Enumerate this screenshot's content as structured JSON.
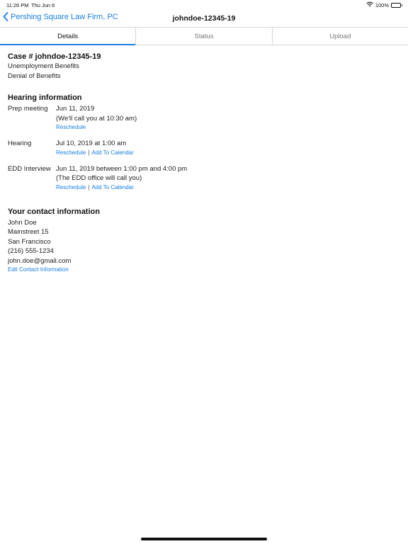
{
  "status_bar": {
    "time": "11:26 PM",
    "date": "Thu Jun 6",
    "battery": "100%"
  },
  "nav": {
    "back_label": "Pershing Square Law Firm, PC",
    "title": "johndoe-12345-19"
  },
  "tabs": [
    {
      "label": "Details",
      "active": true
    },
    {
      "label": "Status",
      "active": false
    },
    {
      "label": "Upload",
      "active": false
    }
  ],
  "case": {
    "title": "Case # johndoe-12345-19",
    "lines": [
      "Unemployment Benefits",
      "Denial of Benefits"
    ]
  },
  "hearing": {
    "heading": "Hearing information",
    "items": [
      {
        "label": "Prep meeting",
        "lines": [
          "Jun 11, 2019",
          "(We'll call you at 10:30 am)"
        ],
        "reschedule": "Reschedule",
        "calendar": ""
      },
      {
        "label": "Hearing",
        "lines": [
          "Jul 10, 2019 at 1:00 am"
        ],
        "reschedule": "Reschedule",
        "calendar": "Add To Calendar"
      },
      {
        "label": "EDD Interview",
        "lines": [
          "Jun 11, 2019 between 1:00 pm and 4:00 pm",
          "(The EDD office will call you)"
        ],
        "reschedule": "Reschedule",
        "calendar": "Add To Calendar"
      }
    ],
    "separator": "|"
  },
  "contact": {
    "heading": "Your contact information",
    "name": "John Doe",
    "street": "Mainstreet 15",
    "city": "San Francisco",
    "phone": "(216) 555-1234",
    "email": "john.doe@gmail.com",
    "edit_label": "Edit Contact Information"
  },
  "colors": {
    "accent": "#1a7fe0",
    "text": "#111111",
    "border": "#d6d6d6"
  }
}
